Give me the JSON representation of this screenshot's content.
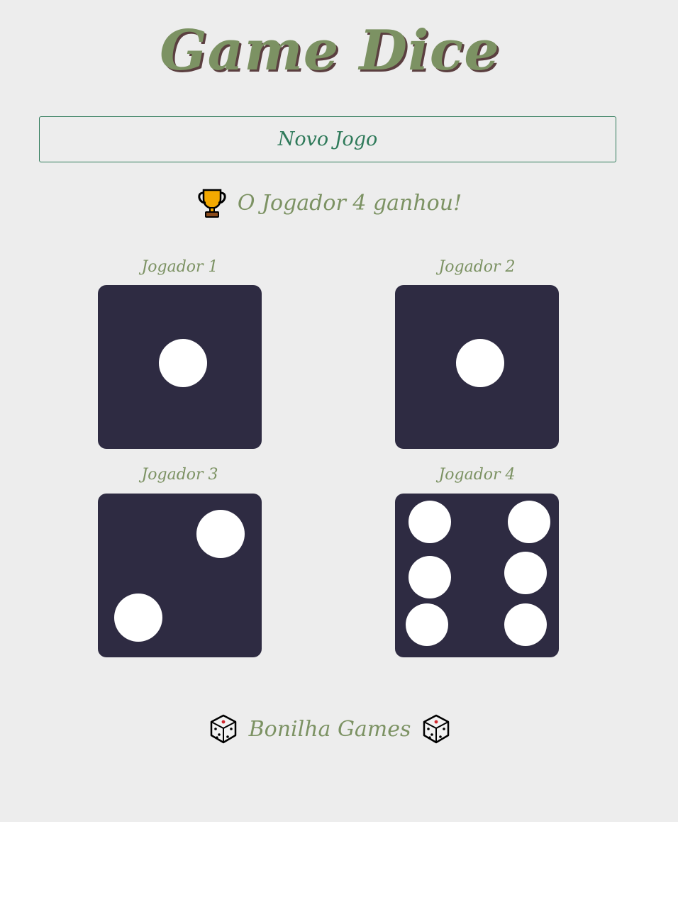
{
  "header": {
    "title": "Game Dice"
  },
  "controls": {
    "new_game_label": "Novo Jogo"
  },
  "result": {
    "icon": "trophy-icon",
    "text": "O Jogador 4 ganhou!"
  },
  "players": [
    {
      "label": "Jogador 1",
      "value": 1
    },
    {
      "label": "Jogador 2",
      "value": 1
    },
    {
      "label": "Jogador 3",
      "value": 2
    },
    {
      "label": "Jogador 4",
      "value": 6
    }
  ],
  "footer": {
    "icon": "die-icon",
    "text": "Bonilha Games"
  },
  "colors": {
    "background": "#ededed",
    "accent_green": "#7c9263",
    "button_green": "#2f7a5a",
    "die_face": "#2e2b42",
    "pip": "#ffffff"
  }
}
